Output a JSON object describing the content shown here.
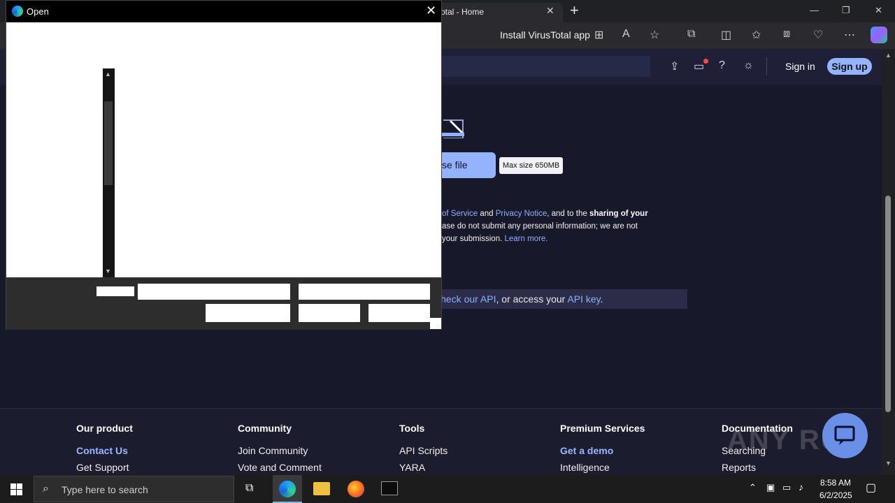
{
  "browser": {
    "tab_title": "otal - Home",
    "tab_close": "✕",
    "new_tab": "+",
    "window_controls": [
      "—",
      "❐",
      "✕"
    ],
    "install_label": "Install VirusTotal app",
    "toolbar_icons": [
      "install-app-icon",
      "read-aloud-icon",
      "favorite-star-icon",
      "extensions-icon",
      "split-screen-icon",
      "favorites-icon",
      "collections-icon",
      "browser-essentials-icon",
      "more-icon",
      "copilot-icon"
    ]
  },
  "site_header": {
    "signin": "Sign in",
    "signup": "Sign up",
    "icons": [
      "upload-icon",
      "chat-icon",
      "help-icon",
      "theme-icon"
    ]
  },
  "upload": {
    "choose_file": "se file",
    "max_size": "Max size 650MB"
  },
  "terms": {
    "line1_pre": "of Service",
    "line1_and": " and ",
    "line1_privacy": "Privacy Notice",
    "line1_mid": ", and to the ",
    "line1_bold": "sharing of your",
    "line2": "ase do not submit any personal information; we are not",
    "line3_pre": "your submission. ",
    "line3_link": "Learn more."
  },
  "api_bar": {
    "link1": "Check our API",
    "mid": ", or access your ",
    "link2": "API key",
    "end": "."
  },
  "footer": {
    "columns": [
      {
        "title": "Our product",
        "items": [
          "Contact Us",
          "Get Support"
        ]
      },
      {
        "title": "Community",
        "items": [
          "Join Community",
          "Vote and Comment"
        ]
      },
      {
        "title": "Tools",
        "items": [
          "API Scripts",
          "YARA"
        ]
      },
      {
        "title": "Premium Services",
        "items": [
          "Get a demo",
          "Intelligence"
        ]
      },
      {
        "title": "Documentation",
        "items": [
          "Searching",
          "Reports"
        ]
      }
    ]
  },
  "watermark": "ANY RUN",
  "dialog": {
    "title": "Open",
    "close": "✕"
  },
  "taskbar": {
    "search_placeholder": "Type here to search",
    "time": "8:58 AM",
    "date": "6/2/2025"
  }
}
